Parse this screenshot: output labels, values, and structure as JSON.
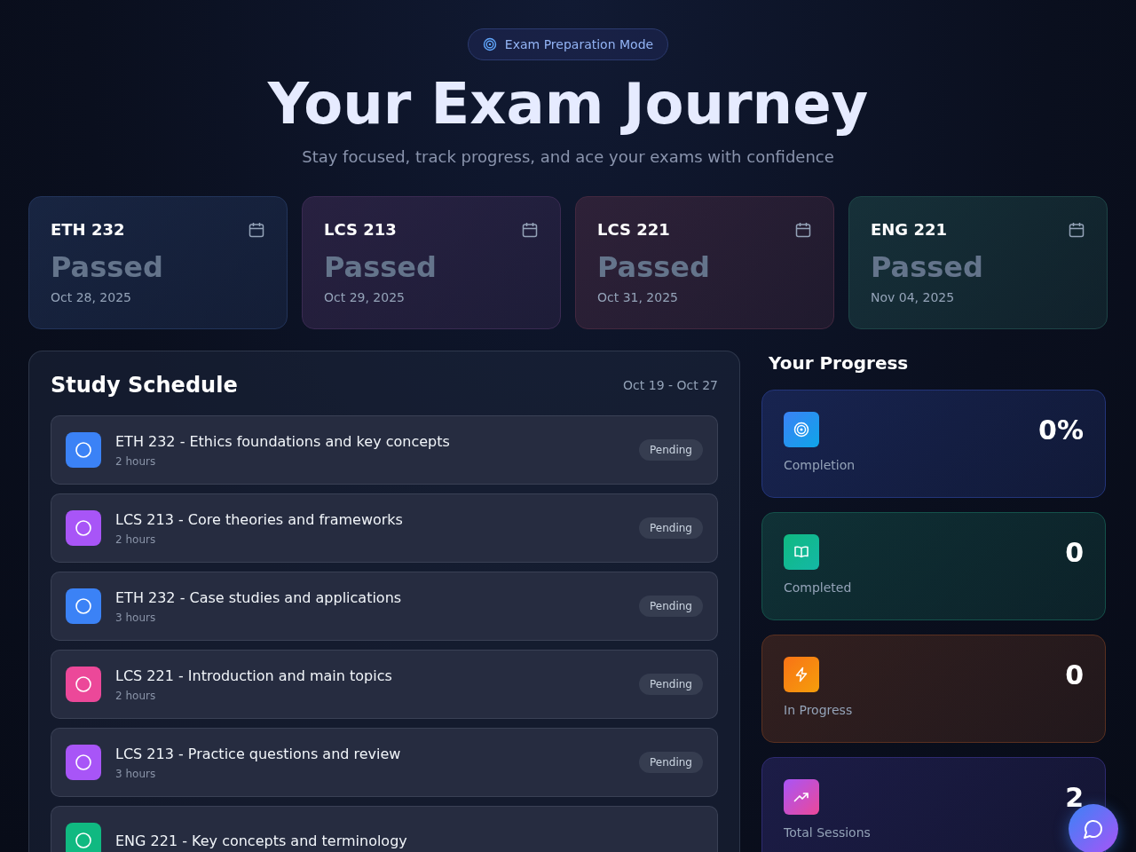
{
  "mode_badge": {
    "label": "Exam Preparation Mode"
  },
  "header": {
    "title": "Your Exam Journey",
    "subtitle": "Stay focused, track progress, and ace your exams with confidence"
  },
  "exams": [
    {
      "course": "ETH 232",
      "status": "Passed",
      "date": "Oct 28, 2025",
      "color": "#22345a"
    },
    {
      "course": "LCS 213",
      "status": "Passed",
      "date": "Oct 29, 2025",
      "color": "#3a2a52"
    },
    {
      "course": "LCS 221",
      "status": "Passed",
      "date": "Oct 31, 2025",
      "color": "#43283f"
    },
    {
      "course": "ENG 221",
      "status": "Passed",
      "date": "Nov 04, 2025",
      "color": "#1d4446"
    }
  ],
  "schedule": {
    "title": "Study Schedule",
    "range": "Oct 19 - Oct 27",
    "sessions": [
      {
        "title": "ETH 232 - Ethics foundations and key concepts",
        "duration": "2 hours",
        "status": "Pending",
        "color": "#3b82f6"
      },
      {
        "title": "LCS 213 - Core theories and frameworks",
        "duration": "2 hours",
        "status": "Pending",
        "color": "#a855f7"
      },
      {
        "title": "ETH 232 - Case studies and applications",
        "duration": "3 hours",
        "status": "Pending",
        "color": "#3b82f6"
      },
      {
        "title": "LCS 221 - Introduction and main topics",
        "duration": "2 hours",
        "status": "Pending",
        "color": "#ec4899"
      },
      {
        "title": "LCS 213 - Practice questions and review",
        "duration": "3 hours",
        "status": "Pending",
        "color": "#a855f7"
      },
      {
        "title": "ENG 221 - Key concepts and terminology",
        "color": "#10b981"
      }
    ]
  },
  "progress": {
    "title": "Your Progress",
    "stats": [
      {
        "kind": "target",
        "value": "0%",
        "label": "Completion",
        "color": "#23357a"
      },
      {
        "kind": "book",
        "value": "0",
        "label": "Completed",
        "color": "#14514a"
      },
      {
        "kind": "bolt",
        "value": "0",
        "label": "In Progress",
        "color": "#5a3020"
      },
      {
        "kind": "trend",
        "value": "2",
        "label": "Total Sessions",
        "color": "#2e2a70"
      }
    ]
  }
}
